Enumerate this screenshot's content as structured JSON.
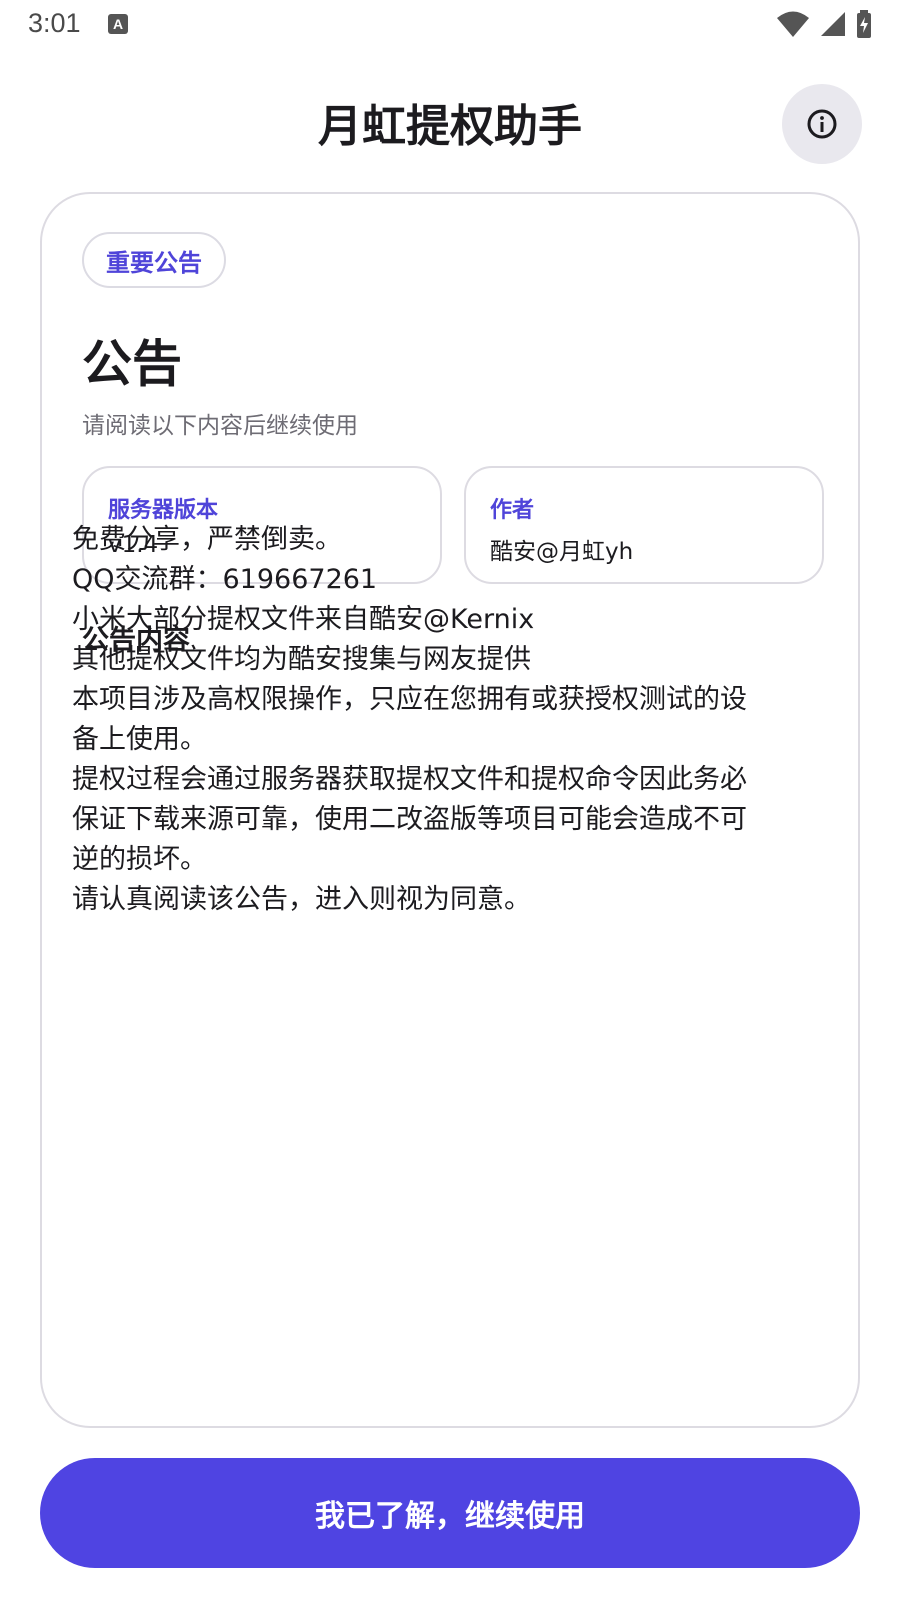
{
  "status_bar": {
    "time": "3:01",
    "a_icon": "A"
  },
  "header": {
    "title": "月虹提权助手",
    "info_icon": "info-icon"
  },
  "card": {
    "badge": "重要公告",
    "title": "公告",
    "subtitle": "请阅读以下内容后继续使用",
    "server_version": {
      "label": "服务器版本",
      "value": "v1.4"
    },
    "author": {
      "label": "作者",
      "value": "酷安@月虹yh"
    },
    "section_title": "公告内容",
    "content": "免费分享，严禁倒卖。\nQQ交流群：619667261\n小米大部分提权文件来自酷安@Kernix\n其他提权文件均为酷安搜集与网友提供\n本项目涉及高权限操作，只应在您拥有或获授权测试的设备上使用。\n提权过程会通过服务器获取提权文件和提权命令因此务必保证下载来源可靠，使用二改盗版等项目可能会造成不可逆的损坏。\n请认真阅读该公告，进入则视为同意。"
  },
  "button": {
    "label": "我已了解，继续使用"
  },
  "colors": {
    "accent": "#4f44e2",
    "accent_text": "#4f44d9",
    "border": "#dddbe2"
  }
}
